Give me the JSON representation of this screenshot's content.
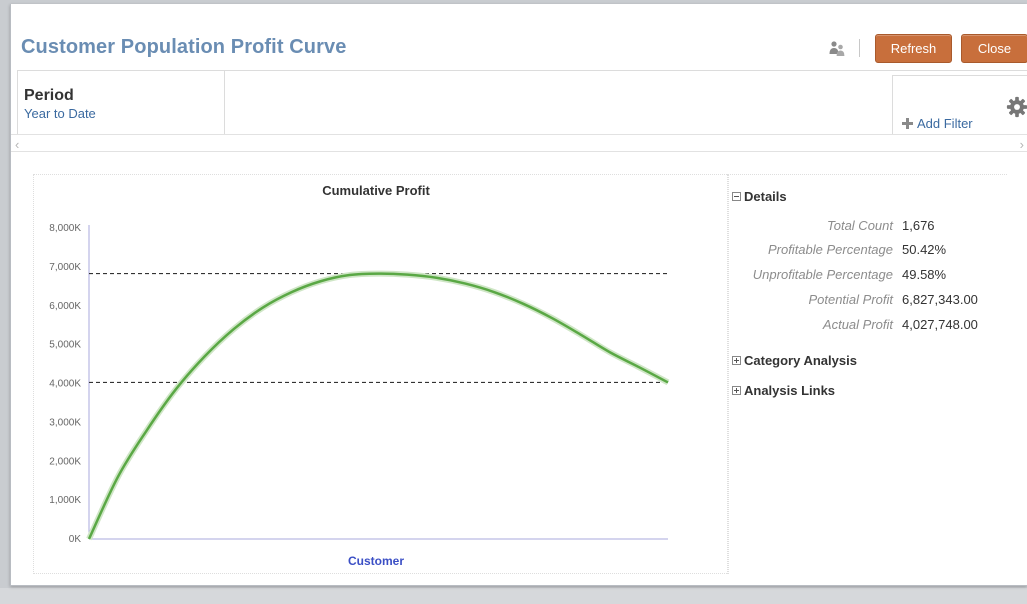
{
  "dialog": {
    "title": "Customer Population Profit Curve",
    "refresh_label": "Refresh",
    "close_label": "Close",
    "user_icon": "user-group-icon",
    "accent_color": "#c86f3c",
    "title_color": "#6a8db3"
  },
  "filters": {
    "period_label": "Period",
    "period_value": "Year to Date",
    "add_filter_label": "Add Filter",
    "settings_icon": "gear-icon"
  },
  "chart_data": {
    "type": "line",
    "title": "Cumulative Profit",
    "xlabel": "Customer",
    "ylabel": "",
    "ylim": [
      0,
      8000000
    ],
    "yticks": [
      "0K",
      "1,000K",
      "2,000K",
      "3,000K",
      "4,000K",
      "5,000K",
      "6,000K",
      "7,000K",
      "8,000K"
    ],
    "grid": false,
    "series_color": "#5aa845",
    "x": [
      0,
      0.05,
      0.1,
      0.15,
      0.2,
      0.25,
      0.3,
      0.35,
      0.4,
      0.45,
      0.5,
      0.55,
      0.6,
      0.65,
      0.7,
      0.75,
      0.8,
      0.85,
      0.9,
      0.95,
      1.0
    ],
    "y": [
      0,
      1600000,
      2800000,
      3850000,
      4700000,
      5400000,
      5950000,
      6350000,
      6630000,
      6790000,
      6827343,
      6800000,
      6720000,
      6570000,
      6350000,
      6050000,
      5680000,
      5250000,
      4800000,
      4420000,
      4027748
    ],
    "reference_lines": [
      {
        "value": 6827343,
        "style": "dashed"
      },
      {
        "value": 4027748,
        "style": "dashed"
      }
    ]
  },
  "details": {
    "header": "Details",
    "rows": [
      {
        "label": "Total Count",
        "value": "1,676"
      },
      {
        "label": "Profitable Percentage",
        "value": "50.42%"
      },
      {
        "label": "Unprofitable Percentage",
        "value": "49.58%"
      },
      {
        "label": "Potential Profit",
        "value": "6,827,343.00"
      },
      {
        "label": "Actual Profit",
        "value": "4,027,748.00"
      }
    ],
    "category_analysis": "Category Analysis",
    "analysis_links": "Analysis Links"
  }
}
